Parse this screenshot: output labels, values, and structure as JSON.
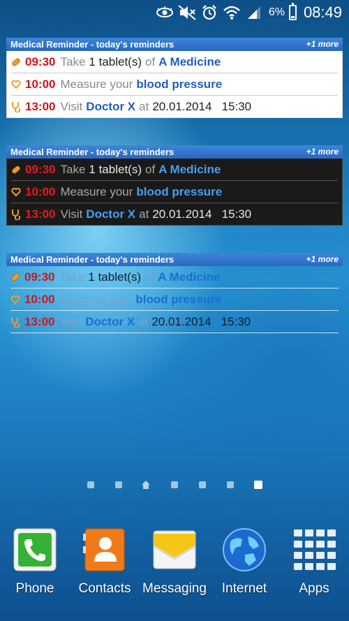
{
  "status": {
    "battery": "6%",
    "time": "08:49"
  },
  "widgets": [
    {
      "style": "light",
      "title": "Medical Reminder - today's reminders",
      "more": "+1 more"
    },
    {
      "style": "dark",
      "title": "Medical Reminder - today's reminders",
      "more": "+1 more"
    },
    {
      "style": "clear",
      "title": "Medical Reminder - today's reminders",
      "more": "+1 more"
    }
  ],
  "reminders": [
    {
      "icon": "pill-icon",
      "time": "09:30",
      "verb": "Take",
      "qty": "1 tablet(s)",
      "connector": "of",
      "subject": "A Medicine",
      "date": ""
    },
    {
      "icon": "heart-icon",
      "time": "10:00",
      "verb": "Measure your",
      "qty": "",
      "connector": "",
      "subject": "blood pressure",
      "date": ""
    },
    {
      "icon": "stethoscope-icon",
      "time": "13:00",
      "verb": "Visit",
      "qty": "",
      "connector": "",
      "subject": "Doctor X",
      "date": "at",
      "datetime": "20.01.2014   15:30"
    }
  ],
  "dock": [
    {
      "label": "Phone"
    },
    {
      "label": "Contacts"
    },
    {
      "label": "Messaging"
    },
    {
      "label": "Internet"
    },
    {
      "label": "Apps"
    }
  ],
  "colors": {
    "time": "#d0141b",
    "link": "#1f5fc4",
    "header": "#2a68c0"
  }
}
